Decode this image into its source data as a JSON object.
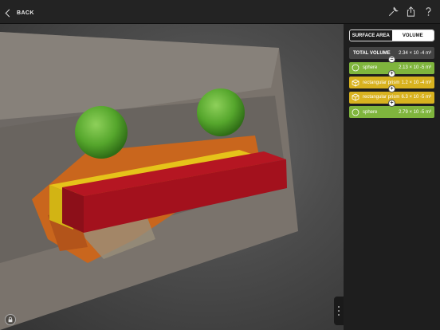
{
  "topbar": {
    "back_label": "BACK",
    "icons": [
      "wrench-icon",
      "share-icon",
      "help-icon"
    ]
  },
  "panel": {
    "tabs": [
      {
        "label": "SURFACE AREA",
        "selected": false
      },
      {
        "label": "VOLUME",
        "selected": true
      }
    ],
    "total": {
      "label": "TOTAL VOLUME",
      "value": "2.34 × 10 -4 m³"
    },
    "shapes": [
      {
        "type": "sphere",
        "label": "sphere",
        "value": "2.13 × 10 -5 m³",
        "color": "#7fb53d"
      },
      {
        "type": "prism",
        "label": "rectangular prism",
        "value": "1.2 × 10 -4 m³",
        "color": "#d8b21f"
      },
      {
        "type": "prism",
        "label": "rectangular prism",
        "value": "6.3 × 10 -5 m³",
        "color": "#d8b21f"
      },
      {
        "type": "sphere",
        "label": "sphere",
        "value": "2.79 × 10 -5 m³",
        "color": "#7fb53d"
      }
    ],
    "operators": [
      "=",
      "+",
      "+",
      "+"
    ]
  },
  "colors": {
    "sphere": "#55a62c",
    "prism_red": "#a3111d",
    "prism_yellow": "#d2b414"
  }
}
